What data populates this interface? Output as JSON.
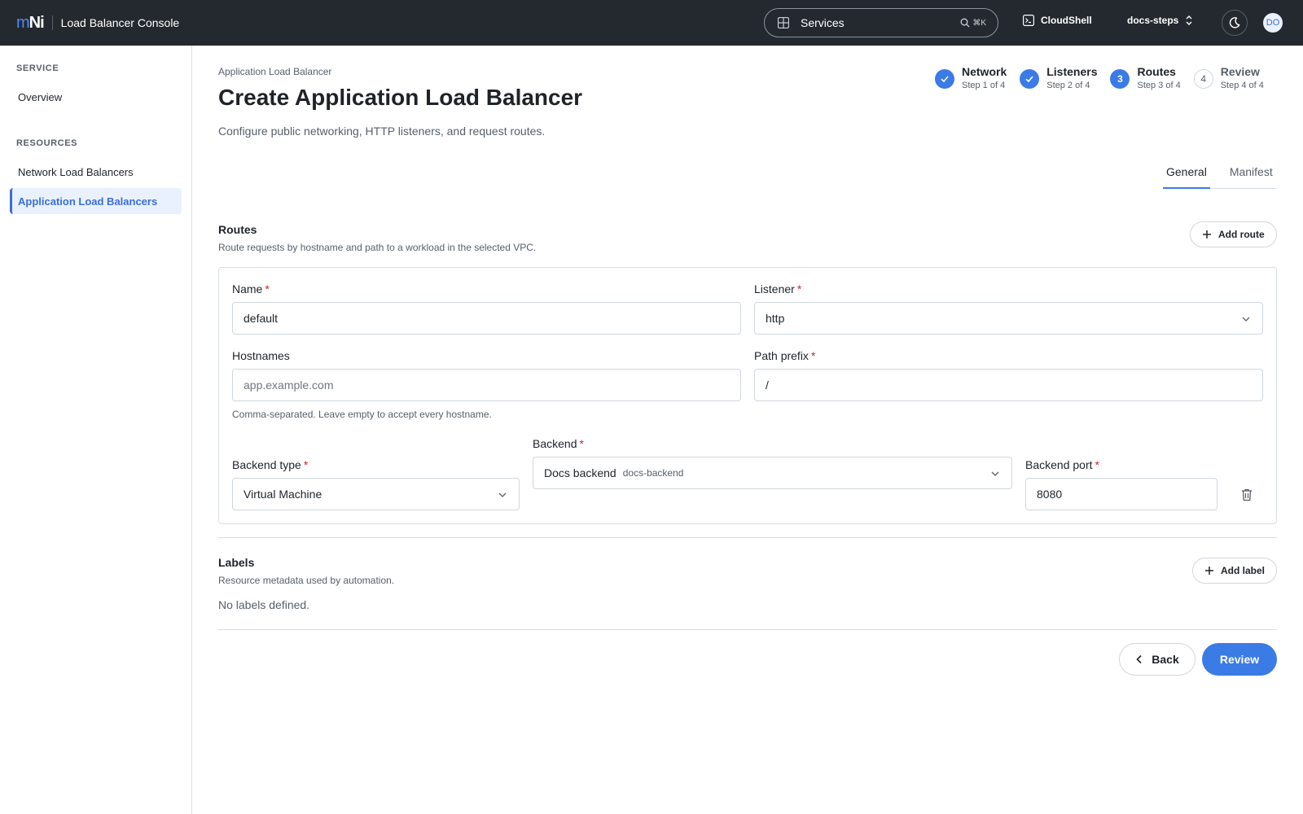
{
  "topbar": {
    "logo_left": "m",
    "logo_right": "Ni",
    "app_title": "Load Balancer Console",
    "search_label": "Services",
    "search_shortcut": "⌘K",
    "cloudshell_label": "CloudShell",
    "project_label": "docs-steps",
    "avatar_initials": "DO"
  },
  "sidebar": {
    "sections": [
      {
        "title": "SERVICE",
        "items": [
          {
            "label": "Overview",
            "active": false
          }
        ]
      },
      {
        "title": "RESOURCES",
        "items": [
          {
            "label": "Network Load Balancers",
            "active": false
          },
          {
            "label": "Application Load Balancers",
            "active": true
          }
        ]
      }
    ]
  },
  "header": {
    "breadcrumb": "Application Load Balancer",
    "title": "Create Application Load Balancer",
    "subtitle": "Configure public networking, HTTP listeners, and request routes."
  },
  "steps": [
    {
      "marker": "",
      "name": "Network",
      "sub": "Step 1 of 4",
      "state": "done"
    },
    {
      "marker": "",
      "name": "Listeners",
      "sub": "Step 2 of 4",
      "state": "done"
    },
    {
      "marker": "3",
      "name": "Routes",
      "sub": "Step 3 of 4",
      "state": "current"
    },
    {
      "marker": "4",
      "name": "Review",
      "sub": "Step 4 of 4",
      "state": "todo"
    }
  ],
  "tabs": [
    {
      "label": "General",
      "active": true
    },
    {
      "label": "Manifest",
      "active": false
    }
  ],
  "routes": {
    "title": "Routes",
    "description": "Route requests by hostname and path to a workload in the selected VPC.",
    "add_button": "Add route",
    "name_label": "Name",
    "name_value": "default",
    "listener_label": "Listener",
    "listener_value": "http",
    "hostnames_label": "Hostnames",
    "hostnames_placeholder": "app.example.com",
    "hostnames_hint": "Comma-separated. Leave empty to accept every hostname.",
    "path_label": "Path prefix",
    "path_value": "/",
    "backend_type_label": "Backend type",
    "backend_type_value": "Virtual Machine",
    "backend_label": "Backend",
    "backend_value": "Docs backend",
    "backend_sub": "docs-backend",
    "backend_port_label": "Backend port",
    "backend_port_value": "8080",
    "required_mark": "*"
  },
  "labels": {
    "title": "Labels",
    "description": "Resource metadata used by automation.",
    "add_button": "Add label",
    "empty": "No labels defined."
  },
  "footer": {
    "back_label": "Back",
    "review_label": "Review"
  },
  "colors": {
    "accent": "#3b7be6",
    "topbar": "#24292f",
    "required": "#cf222e"
  }
}
